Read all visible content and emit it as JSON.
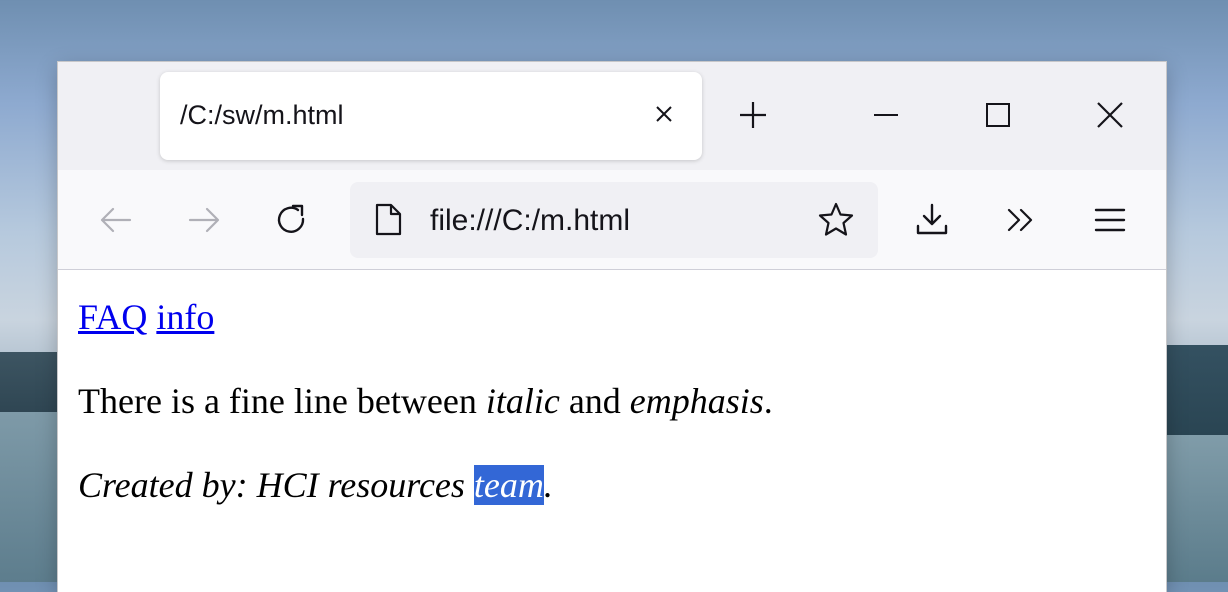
{
  "tab": {
    "title": "/C:/sw/m.html"
  },
  "toolbar": {
    "url": "file:///C:/m.html",
    "icons": [
      "back-icon",
      "forward-icon",
      "reload-icon",
      "page-icon",
      "bookmark-star-icon",
      "download-icon",
      "overflow-icon",
      "menu-icon"
    ]
  },
  "page": {
    "links": [
      "FAQ",
      "info"
    ],
    "para1": {
      "before": "There is a fine line between ",
      "italic1": "italic",
      "middle": " and ",
      "italic2": "emphasis",
      "after": "."
    },
    "para2": {
      "text": "Created by: HCI resources ",
      "selected": "team",
      "after": "."
    }
  },
  "colors": {
    "link": "#0000ee",
    "selection": "#3367d6",
    "tabbar": "#f0f0f4"
  }
}
